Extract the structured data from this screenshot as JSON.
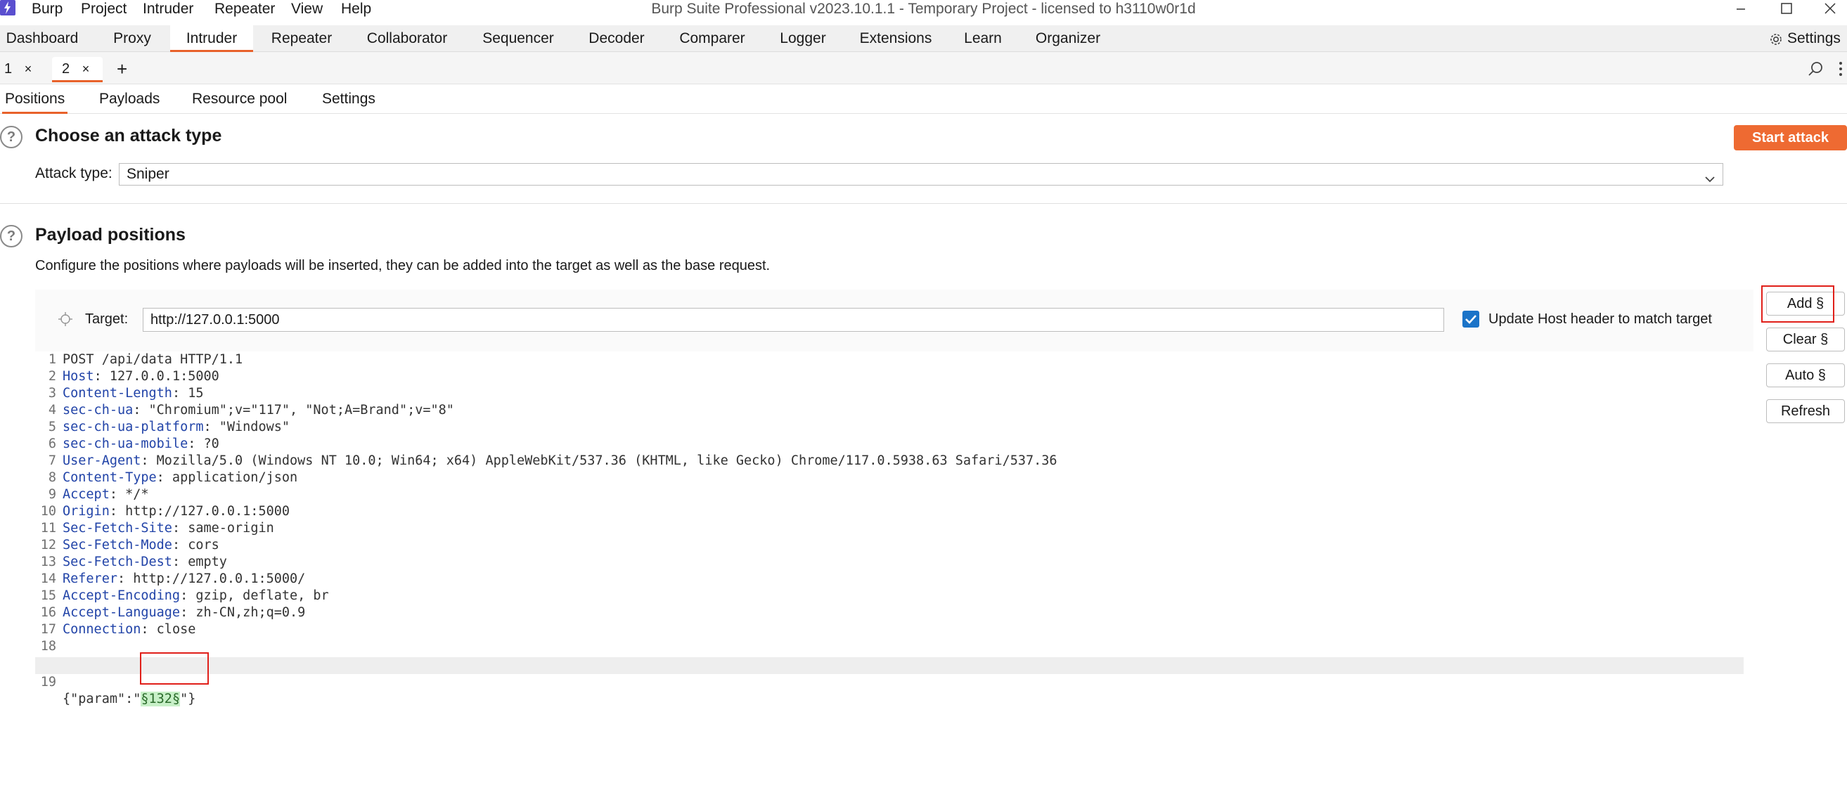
{
  "app": {
    "logo_icon": "burp-lightning-icon",
    "title": "Burp Suite Professional v2023.10.1.1 - Temporary Project - licensed to h3110w0r1d",
    "menu": [
      "Burp",
      "Project",
      "Intruder",
      "Repeater",
      "View",
      "Help"
    ],
    "window_controls": [
      "minimize-icon",
      "maximize-icon",
      "close-icon"
    ]
  },
  "nav": {
    "tabs": [
      "Dashboard",
      "Proxy",
      "Intruder",
      "Repeater",
      "Collaborator",
      "Sequencer",
      "Decoder",
      "Comparer",
      "Logger",
      "Extensions",
      "Learn",
      "Organizer"
    ],
    "active": "Intruder",
    "settings_label": "Settings",
    "settings_icon": "gear-icon"
  },
  "intruder_tabs": {
    "tabs": [
      {
        "label": "1",
        "close": "×"
      },
      {
        "label": "2",
        "close": "×"
      }
    ],
    "active": "2",
    "add": "+",
    "search_icon": "search-icon",
    "more_icon": "kebab-menu-icon"
  },
  "section_tabs": {
    "tabs": [
      "Positions",
      "Payloads",
      "Resource pool",
      "Settings"
    ],
    "active": "Positions"
  },
  "attack_type": {
    "heading": "Choose an attack type",
    "start_button": "Start attack",
    "label": "Attack type:",
    "value": "Sniper"
  },
  "payload_positions": {
    "heading": "Payload positions",
    "description": "Configure the positions where payloads will be inserted, they can be added into the target as well as the base request.",
    "target_label": "Target:",
    "target_value": "http://127.0.0.1:5000",
    "update_host_label": "Update Host header to match target",
    "update_host_checked": true,
    "buttons": {
      "add": "Add §",
      "clear": "Clear §",
      "auto": "Auto §",
      "refresh": "Refresh"
    }
  },
  "request": {
    "lines": [
      {
        "n": "1",
        "name": "",
        "value": "POST /api/data HTTP/1.1"
      },
      {
        "n": "2",
        "name": "Host",
        "value": ": 127.0.0.1:5000"
      },
      {
        "n": "3",
        "name": "Content-Length",
        "value": ": 15"
      },
      {
        "n": "4",
        "name": "sec-ch-ua",
        "value": ": \"Chromium\";v=\"117\", \"Not;A=Brand\";v=\"8\""
      },
      {
        "n": "5",
        "name": "sec-ch-ua-platform",
        "value": ": \"Windows\""
      },
      {
        "n": "6",
        "name": "sec-ch-ua-mobile",
        "value": ": ?0"
      },
      {
        "n": "7",
        "name": "User-Agent",
        "value": ": Mozilla/5.0 (Windows NT 10.0; Win64; x64) AppleWebKit/537.36 (KHTML, like Gecko) Chrome/117.0.5938.63 Safari/537.36"
      },
      {
        "n": "8",
        "name": "Content-Type",
        "value": ": application/json"
      },
      {
        "n": "9",
        "name": "Accept",
        "value": ": */*"
      },
      {
        "n": "10",
        "name": "Origin",
        "value": ": http://127.0.0.1:5000"
      },
      {
        "n": "11",
        "name": "Sec-Fetch-Site",
        "value": ": same-origin"
      },
      {
        "n": "12",
        "name": "Sec-Fetch-Mode",
        "value": ": cors"
      },
      {
        "n": "13",
        "name": "Sec-Fetch-Dest",
        "value": ": empty"
      },
      {
        "n": "14",
        "name": "Referer",
        "value": ": http://127.0.0.1:5000/"
      },
      {
        "n": "15",
        "name": "Accept-Encoding",
        "value": ": gzip, deflate, br"
      },
      {
        "n": "16",
        "name": "Accept-Language",
        "value": ": zh-CN,zh;q=0.9"
      },
      {
        "n": "17",
        "name": "Connection",
        "value": ": close"
      },
      {
        "n": "18",
        "name": "",
        "value": ""
      }
    ],
    "body_line": {
      "n": "19",
      "prefix": "{\"param\":\"",
      "payload": "§132§",
      "suffix": "\"}"
    }
  }
}
